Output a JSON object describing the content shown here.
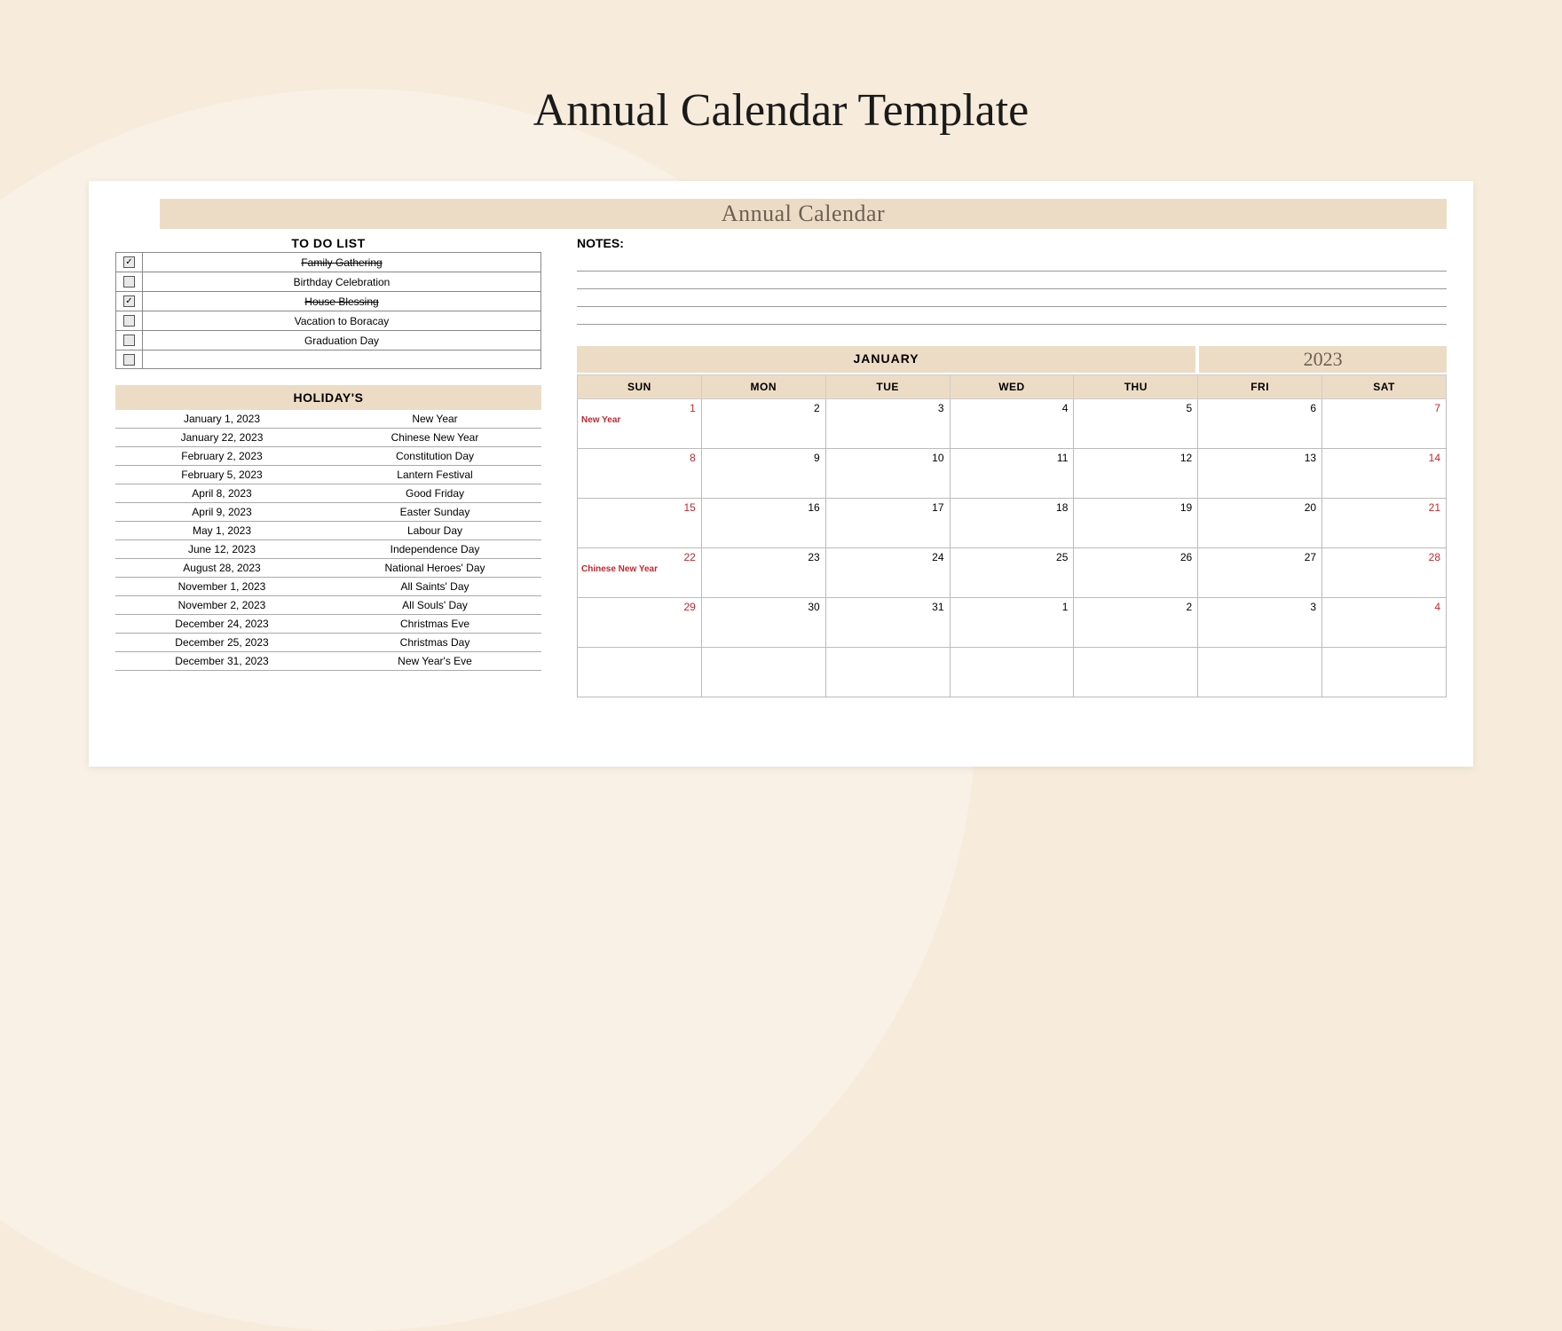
{
  "pageTitle": "Annual Calendar Template",
  "banner": "Annual Calendar",
  "todo": {
    "title": "TO DO LIST",
    "items": [
      {
        "done": true,
        "label": "Family Gathering"
      },
      {
        "done": false,
        "label": "Birthday Celebration"
      },
      {
        "done": true,
        "label": "House Blessing"
      },
      {
        "done": false,
        "label": "Vacation to Boracay"
      },
      {
        "done": false,
        "label": "Graduation Day"
      },
      {
        "done": false,
        "label": ""
      }
    ]
  },
  "holidays": {
    "title": "HOLIDAY'S",
    "items": [
      {
        "date": "January 1, 2023",
        "name": "New Year"
      },
      {
        "date": "January 22, 2023",
        "name": "Chinese New Year"
      },
      {
        "date": "February 2, 2023",
        "name": "Constitution Day"
      },
      {
        "date": "February 5, 2023",
        "name": "Lantern Festival"
      },
      {
        "date": "April 8, 2023",
        "name": "Good Friday"
      },
      {
        "date": "April 9, 2023",
        "name": "Easter Sunday"
      },
      {
        "date": "May 1, 2023",
        "name": "Labour Day"
      },
      {
        "date": "June 12, 2023",
        "name": "Independence Day"
      },
      {
        "date": "August 28, 2023",
        "name": "National Heroes' Day"
      },
      {
        "date": "November 1, 2023",
        "name": "All Saints' Day"
      },
      {
        "date": "November 2, 2023",
        "name": "All Souls' Day"
      },
      {
        "date": "December 24, 2023",
        "name": "Christmas Eve"
      },
      {
        "date": "December 25, 2023",
        "name": "Christmas Day"
      },
      {
        "date": "December 31, 2023",
        "name": "New Year's Eve"
      }
    ]
  },
  "notesTitle": "NOTES:",
  "month": "JANUARY",
  "year": "2023",
  "days": [
    "SUN",
    "MON",
    "TUE",
    "WED",
    "THU",
    "FRI",
    "SAT"
  ],
  "weeks": [
    [
      {
        "n": "1",
        "we": true,
        "ev": "New Year"
      },
      {
        "n": "2"
      },
      {
        "n": "3"
      },
      {
        "n": "4"
      },
      {
        "n": "5"
      },
      {
        "n": "6"
      },
      {
        "n": "7",
        "we": true
      }
    ],
    [
      {
        "n": "8",
        "we": true
      },
      {
        "n": "9"
      },
      {
        "n": "10"
      },
      {
        "n": "11"
      },
      {
        "n": "12"
      },
      {
        "n": "13"
      },
      {
        "n": "14",
        "we": true
      }
    ],
    [
      {
        "n": "15",
        "we": true
      },
      {
        "n": "16"
      },
      {
        "n": "17"
      },
      {
        "n": "18"
      },
      {
        "n": "19"
      },
      {
        "n": "20"
      },
      {
        "n": "21",
        "we": true
      }
    ],
    [
      {
        "n": "22",
        "we": true,
        "ev": "Chinese New Year"
      },
      {
        "n": "23"
      },
      {
        "n": "24"
      },
      {
        "n": "25"
      },
      {
        "n": "26"
      },
      {
        "n": "27"
      },
      {
        "n": "28",
        "we": true
      }
    ],
    [
      {
        "n": "29",
        "we": true
      },
      {
        "n": "30"
      },
      {
        "n": "31"
      },
      {
        "n": "1"
      },
      {
        "n": "2"
      },
      {
        "n": "3"
      },
      {
        "n": "4",
        "we": true
      }
    ],
    [
      {
        "n": ""
      },
      {
        "n": ""
      },
      {
        "n": ""
      },
      {
        "n": ""
      },
      {
        "n": ""
      },
      {
        "n": ""
      },
      {
        "n": ""
      }
    ]
  ]
}
